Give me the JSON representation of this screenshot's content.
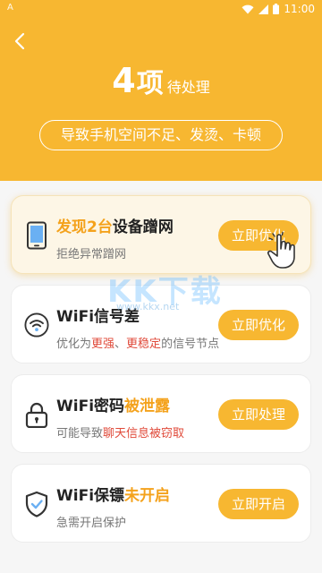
{
  "status": {
    "time": "11:00",
    "left_glyph": "A"
  },
  "header": {
    "count": "4",
    "count_unit": "项",
    "count_suffix": "待处理",
    "subtitle": "导致手机空间不足、发烫、卡顿"
  },
  "cards": [
    {
      "title_accent": "发现2台",
      "title_rest": "设备蹭网",
      "sub": "拒绝异常蹭网",
      "button": "立即优化",
      "icon": "phone-icon"
    },
    {
      "title_accent": "WiFi信号差",
      "sub_pre": "优化为",
      "sub_red1": "更强",
      "sub_mid": "、",
      "sub_red2": "更稳定",
      "sub_post": "的信号节点",
      "button": "立即优化",
      "icon": "wifi-icon"
    },
    {
      "title_plain": "WiFi密码",
      "title_accent": "被泄露",
      "sub_pre": "可能导致",
      "sub_red": "聊天信息被窃取",
      "button": "立即处理",
      "icon": "lock-icon"
    },
    {
      "title_plain": "WiFi保镖",
      "title_accent": "未开启",
      "sub": "急需开启保护",
      "button": "立即开启",
      "icon": "shield-icon"
    }
  ],
  "watermark": {
    "text": "KK下载",
    "url": "www.kkx.net"
  },
  "colors": {
    "brand": "#f7b731",
    "accent": "#f4a21c",
    "warning": "#e04a3a"
  }
}
